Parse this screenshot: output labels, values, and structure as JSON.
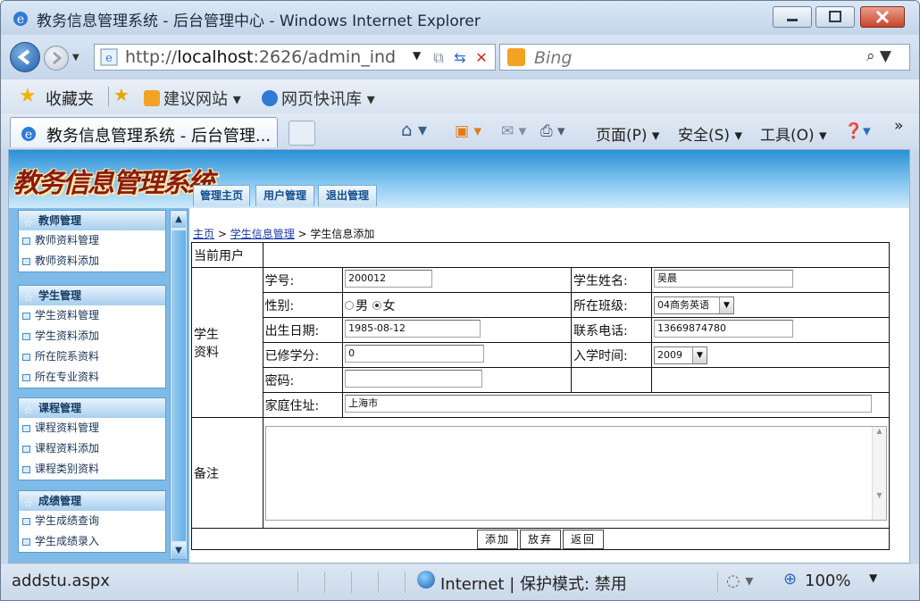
{
  "window": {
    "title": "教务信息管理系统 - 后台管理中心 - Windows Internet Explorer"
  },
  "address": {
    "prefix": "http://",
    "host": "localhost",
    "rest": ":2626/admin_ind",
    "search_placeholder": "Bing"
  },
  "favorites": {
    "label": "收藏夹",
    "items": [
      "建议网站 ▾",
      "网页快讯库 ▾"
    ]
  },
  "tab": {
    "label": "教务信息管理系统 - 后台管理..."
  },
  "commands": {
    "page": "页面(P) ▾",
    "safety": "安全(S) ▾",
    "tools": "工具(O) ▾"
  },
  "app": {
    "logo": "教务信息管理系统",
    "nav_tabs": [
      "管理主页",
      "用户管理",
      "退出管理"
    ]
  },
  "sidebar": {
    "groups": [
      {
        "title": "教师管理",
        "items": [
          "教师资料管理",
          "教师资料添加"
        ]
      },
      {
        "title": "学生管理",
        "items": [
          "学生资料管理",
          "学生资料添加",
          "所在院系资料",
          "所在专业资料"
        ]
      },
      {
        "title": "课程管理",
        "items": [
          "课程资料管理",
          "课程资料添加",
          "课程类别资料"
        ]
      },
      {
        "title": "成绩管理",
        "items": [
          "学生成绩查询",
          "学生成绩录入"
        ]
      }
    ]
  },
  "breadcrumb": {
    "home": "主页",
    "sep": " > ",
    "section": "学生信息管理",
    "current": "学生信息添加"
  },
  "form": {
    "current_user_label": "当前用户",
    "student_info_label_1": "学生",
    "student_info_label_2": "资料",
    "student_id_label": "学号:",
    "student_id_value": "200012",
    "name_label": "学生姓名:",
    "name_value": "吴晨",
    "gender_label": "性别:",
    "gender_male": "男",
    "gender_female": "女",
    "class_label": "所在班级:",
    "class_value": "04商务英语",
    "birth_label": "出生日期:",
    "birth_value": "1985-08-12",
    "phone_label": "联系电话:",
    "phone_value": "13669874780",
    "credits_label": "已修学分:",
    "credits_value": "0",
    "enroll_label": "入学时间:",
    "enroll_value": "2009",
    "password_label": "密码:",
    "password_value": "",
    "address_label": "家庭住址:",
    "address_value": "上海市",
    "remarks_label": "备注",
    "remarks_value": ""
  },
  "buttons": {
    "add": "添加",
    "discard": "放弃",
    "back": "返回"
  },
  "status": {
    "url": "addstu.aspx",
    "zone": "Internet | 保护模式: 禁用",
    "zoom": "100%"
  }
}
